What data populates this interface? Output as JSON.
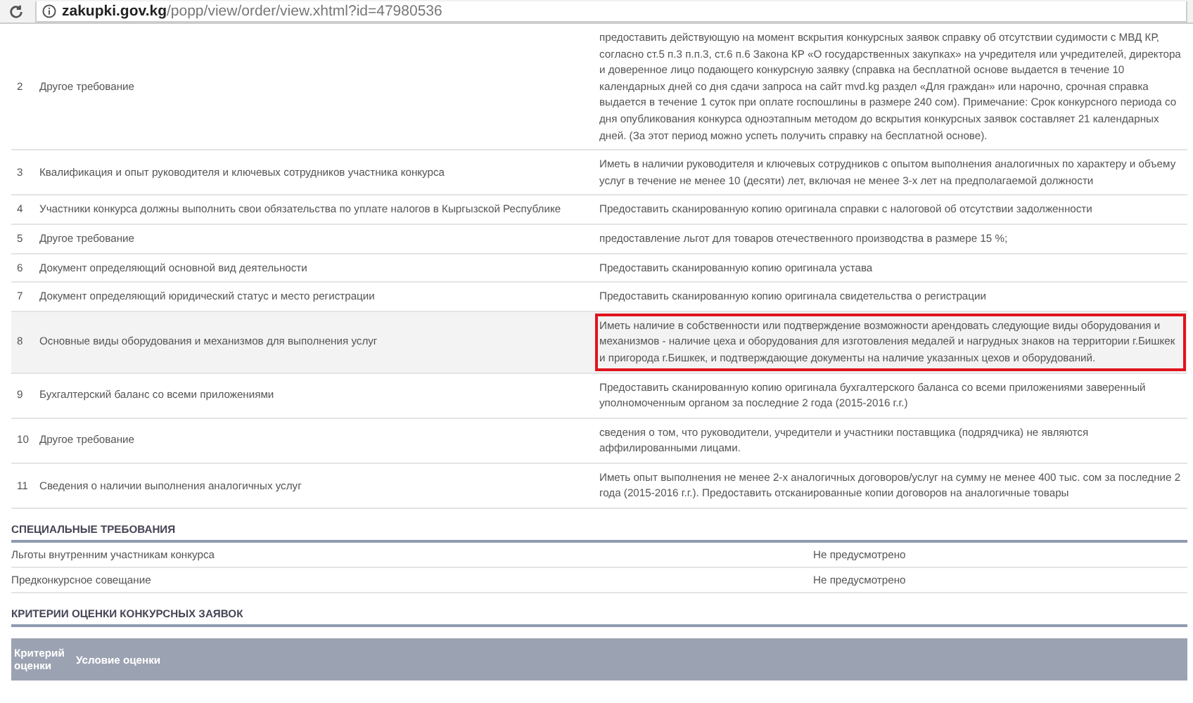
{
  "address_bar": {
    "host": "zakupki.gov.kg",
    "path": "/popp/view/order/view.xhtml?id=47980536"
  },
  "requirements": [
    {
      "number": "2",
      "name": "Другое требование",
      "value": "предоставить действующую на момент вскрытия конкурсных заявок справку об отсутствии судимости с МВД КР, согласно ст.5 п.3 п.п.3, ст.6 п.6 Закона КР «О государственных закупках» на учредителя или учредителей, директора и доверенное лицо подающего конкурсную заявку (справка на бесплатной основе выдается в течение 10 календарных дней со дня сдачи запроса на сайт mvd.kg раздел «Для граждан» или нарочно, срочная справка выдается в течение 1 суток при оплате госпошлины в размере 240 сом). Примечание: Срок конкурсного периода со дня опубликования конкурса одноэтапным методом до вскрытия конкурсных заявок составляет 21 календарных дней. (За этот период можно успеть получить справку на бесплатной основе).",
      "highlighted": false,
      "outlined": false
    },
    {
      "number": "3",
      "name": "Квалификация и опыт руководителя и ключевых сотрудников участника конкурса",
      "value": "Иметь в наличии руководителя и ключевых сотрудников с опытом выполнения аналогичных по характеру и объему услуг в течение не менее 10 (десяти) лет, включая не менее 3-х лет на предполагаемой должности",
      "highlighted": false,
      "outlined": false
    },
    {
      "number": "4",
      "name": "Участники конкурса должны выполнить свои обязательства по уплате налогов в Кыргызской Республике",
      "value": "Предоставить сканированную копию оригинала справки с налоговой об отсутствии задолженности",
      "highlighted": false,
      "outlined": false
    },
    {
      "number": "5",
      "name": "Другое требование",
      "value": "предоставление льгот для товаров отечественного производства в размере 15 %;",
      "highlighted": false,
      "outlined": false
    },
    {
      "number": "6",
      "name": "Документ определяющий основной вид деятельности",
      "value": "Предоставить сканированную копию оригинала устава",
      "highlighted": false,
      "outlined": false
    },
    {
      "number": "7",
      "name": "Документ определяющий юридический статус и место регистрации",
      "value": "Предоставить сканированную копию оригинала свидетельства о регистрации",
      "highlighted": false,
      "outlined": false
    },
    {
      "number": "8",
      "name": "Основные виды оборудования и механизмов для выполнения услуг",
      "value": "Иметь наличие в собственности или подтверждение возможности арендовать следующие виды оборудования и механизмов - наличие цеха и оборудования для изготовления медалей и нагрудных знаков на территории г.Бишкек и пригорода г.Бишкек, и подтверждающие документы на наличие указанных цехов и оборудований.",
      "highlighted": true,
      "outlined": true
    },
    {
      "number": "9",
      "name": "Бухгалтерский баланс со всеми приложениями",
      "value": "Предоставить сканированную копию оригинала бухгалтерского баланса со всеми приложениями заверенный уполномоченным органом за последние 2 года (2015-2016 г.г.)",
      "highlighted": false,
      "outlined": false
    },
    {
      "number": "10",
      "name": "Другое требование",
      "value": "сведения о том, что руководители, учредители и участники поставщика (подрядчика) не являются аффилированными лицами.",
      "highlighted": false,
      "outlined": false
    },
    {
      "number": "11",
      "name": "Сведения о наличии выполнения аналогичных услуг",
      "value": "Иметь опыт выполнения не менее 2-х аналогичных договоров/услуг на сумму не менее 400 тыс. сом за последние 2 года (2015-2016 г.г.). Предоставить отсканированные копии договоров на аналогичные товары",
      "highlighted": false,
      "outlined": false
    }
  ],
  "special_requirements": {
    "title": "СПЕЦИАЛЬНЫЕ ТРЕБОВАНИЯ",
    "rows": [
      {
        "name": "Льготы внутренним участникам конкурса",
        "value": "Не предусмотрено"
      },
      {
        "name": "Предконкурсное совещание",
        "value": "Не предусмотрено"
      }
    ]
  },
  "criteria": {
    "title": "КРИТЕРИИ ОЦЕНКИ КОНКУРСНЫХ ЗАЯВОК",
    "columns": [
      "Критерий оценки",
      "Условие оценки"
    ]
  }
}
